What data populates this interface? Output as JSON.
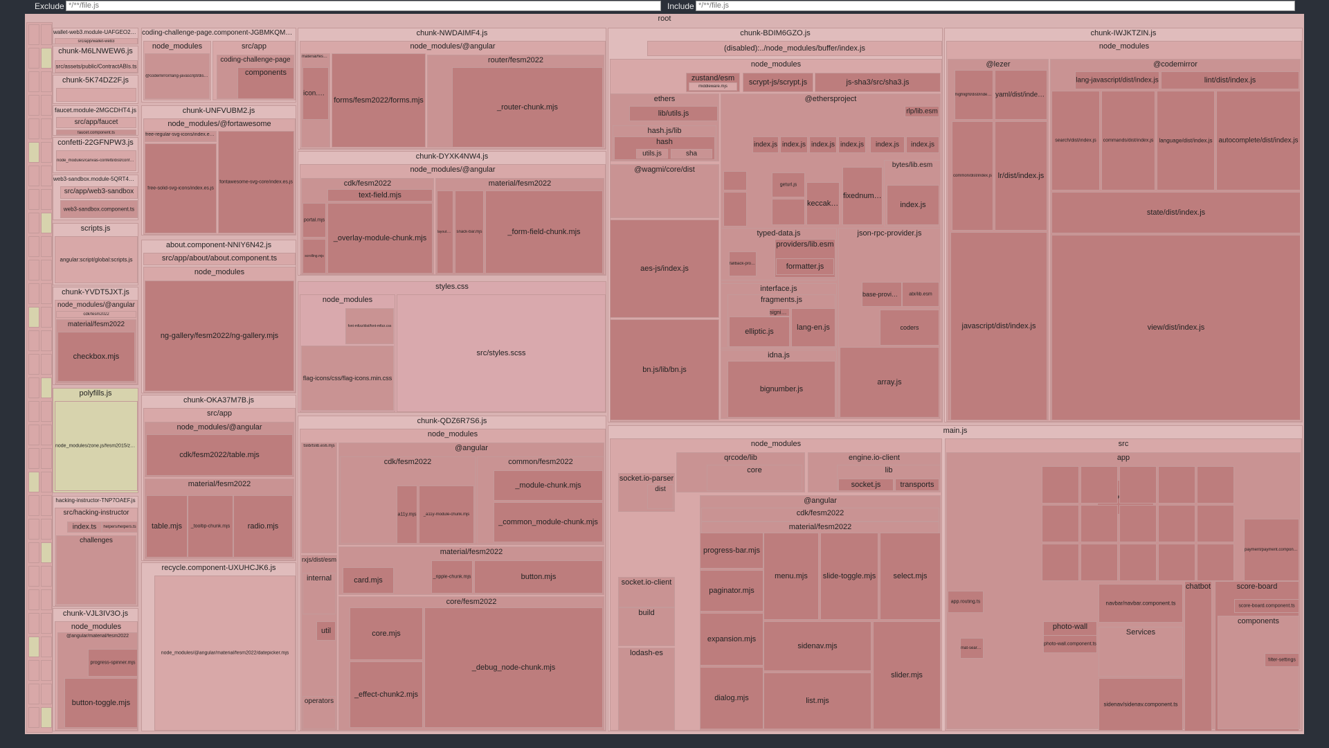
{
  "filters": {
    "exclude_label": "Exclude",
    "exclude_placeholder": "*/**/file.js",
    "include_label": "Include",
    "include_placeholder": "*/**/file.js"
  },
  "colors": {
    "root": "#d9b3b3",
    "default_chunk": "#e0bcbc",
    "polyfills": "#d7d3ad",
    "styles": "#d9a9ad",
    "module_dark": "#bd7d7d",
    "module_mid": "#c99393",
    "module_light": "#d8a8a8"
  },
  "treemap": {
    "root_label": "root",
    "chunks": [
      {
        "name": "wallet-web3.module-UAFGEO2L.js",
        "children": [
          "src/app/wallet-web3"
        ]
      },
      {
        "name": "chunk-M6LNWEW6.js",
        "children": [
          "src/assets/public/ContractABIs.ts"
        ]
      },
      {
        "name": "chunk-5K74DZ2F.js",
        "children": []
      },
      {
        "name": "faucet.module-2MGCDHT4.js",
        "children": [
          "src/app/faucet",
          "faucet.component.ts"
        ]
      },
      {
        "name": "confetti-22GFNPW3.js",
        "children": [
          "node_modules/canvas-confetti/dist/confetti.module.mjs"
        ]
      },
      {
        "name": "web3-sandbox.module-5QRT4YKN.js",
        "children": [
          "src/app/web3-sandbox",
          "web3-sandbox.component.ts"
        ]
      },
      {
        "name": "scripts.js",
        "children": [
          "angular:script/global:scripts.js"
        ]
      },
      {
        "name": "chunk-YVDT5JXT.js",
        "children": [
          "node_modules/@angular",
          "cdk/fesm2022",
          "material/fesm2022",
          "checkbox.mjs"
        ]
      },
      {
        "name": "polyfills.js",
        "children": [
          "node_modules/zone.js/fesm2015/zone.js"
        ]
      },
      {
        "name": "hacking-instructor-TNP7OAEF.js",
        "children": [
          "src/hacking-instructor",
          "index.ts",
          "helpers/helpers.ts",
          "challenges"
        ]
      },
      {
        "name": "chunk-VJL3IV3O.js",
        "children": [
          "node_modules",
          "@angular/material/fesm2022",
          "progress-spinner.mjs",
          "button-toggle.mjs"
        ]
      },
      {
        "name": "coding-challenge-page.component-JGBMKQMB.js",
        "children": [
          "node_modules",
          "src/app",
          "coding-challenge-page",
          "components",
          "@codemirror/lang-javascript/dist/index.js"
        ]
      },
      {
        "name": "chunk-UNFVUBM2.js",
        "children": [
          "node_modules/@fortawesome",
          "free-regular-svg-icons/index.es.js",
          "free-solid-svg-icons/index.es.js",
          "fontawesome-svg-core/index.es.js"
        ]
      },
      {
        "name": "about.component-NNIY6N42.js",
        "children": [
          "src/app/about/about.component.ts",
          "node_modules",
          "ng-gallery/fesm2022/ng-gallery.mjs"
        ]
      },
      {
        "name": "chunk-OKA37M7B.js",
        "children": [
          "src/app",
          "node_modules/@angular",
          "cdk/fesm2022/table.mjs",
          "material/fesm2022",
          "table.mjs",
          "_tooltip-chunk.mjs",
          "radio.mjs"
        ]
      },
      {
        "name": "recycle.component-UXUHCJK6.js",
        "children": [
          "node_modules/@angular/material/fesm2022/datepicker.mjs"
        ]
      },
      {
        "name": "chunk-NWDAIMF4.js",
        "children": [
          "node_modules/@angular",
          "router/fesm2022",
          "icon.mjs",
          "forms/fesm2022/forms.mjs",
          "_router-chunk.mjs",
          "material/fesm2022"
        ]
      },
      {
        "name": "chunk-DYXK4NW4.js",
        "children": [
          "node_modules/@angular",
          "cdk/fesm2022",
          "text-field.mjs",
          "material/fesm2022",
          "portal.mjs",
          "_overlay-module-chunk.mjs",
          "_form-field-chunk.mjs",
          "snack-bar.mjs",
          "scrolling.mjs",
          "layout.mjs"
        ]
      },
      {
        "name": "styles.css",
        "children": [
          "node_modules",
          "flag-icons/css/flag-icons.min.css",
          "font-mfizz/dist/font-mfizz.css",
          "src/styles.scss"
        ]
      },
      {
        "name": "chunk-QDZ6R7S6.js",
        "children": [
          "node_modules",
          "@angular",
          "cdk/fesm2022",
          "common/fesm2022",
          "_module-chunk.mjs",
          "_common_module-chunk.mjs",
          "a11y.mjs",
          "_a11y-module-chunk.mjs",
          "tslib/tslib.es6.mjs",
          "material/fesm2022",
          "card.mjs",
          "_ripple-chunk.mjs",
          "button.mjs",
          "rxjs/dist/esm",
          "internal",
          "util",
          "operators",
          "core/fesm2022",
          "core.mjs",
          "_debug_node-chunk.mjs",
          "_effect-chunk2.mjs"
        ]
      },
      {
        "name": "chunk-BDIM6GZO.js",
        "children": [
          "(disabled):../node_modules/buffer/index.js",
          "node_modules",
          "zustand/esm",
          "middleware.mjs",
          "scrypt-js/scrypt.js",
          "js-sha3/src/sha3.js",
          "ethers",
          "lib/utils.js",
          "hash.js/lib",
          "hash",
          "utils.js",
          "sha",
          "@wagmi/core/dist",
          "aes-js/index.js",
          "bn.js/lib/bn.js",
          "@ethersproject",
          "rlp/lib.esm",
          "index.js",
          "lib.esm",
          "bytes/lib.esm",
          "contracts/lib.esm",
          "hash/lib.esm",
          "ens-normalize",
          "include.js",
          "typed-data.js",
          "providers/lib.esm",
          "formatter.js",
          "fallback-provider.js",
          "json-rpc-provider.js",
          "base-provider.js",
          "abi/lib.esm",
          "coders",
          "array.js",
          "interface.js",
          "fragments.js",
          "signing-key/lib.esm",
          "elliptic.js",
          "lang-en.js",
          "idna.js",
          "bignumber.js",
          "fixednumber.js",
          "keccak256",
          "geturl.js"
        ]
      },
      {
        "name": "chunk-IWJKTZIN.js",
        "children": [
          "node_modules",
          "@lezer",
          "yaml/dist/index.js",
          "lr/dist/index.js",
          "javascript/dist/index.js",
          "highlight/dist/index.js",
          "common/dist/index.js",
          "@codemirror",
          "lang-javascript/dist/index.js",
          "lint/dist/index.js",
          "search/dist/index.js",
          "commands/dist/index.js",
          "language/dist/index.js",
          "autocomplete/dist/index.js",
          "state/dist/index.js",
          "view/dist/index.js"
        ]
      },
      {
        "name": "main.js",
        "children": [
          "node_modules",
          "qrcode/lib",
          "core",
          "engine.io-client",
          "lib",
          "socket.js",
          "transports",
          "socket.io-parser",
          "dist",
          "@angular",
          "cdk/fesm2022",
          "material/fesm2022",
          "progress-bar.mjs",
          "menu.mjs",
          "slide-toggle.mjs",
          "select.mjs",
          "paginator.mjs",
          "sidenav.mjs",
          "expansion.mjs",
          "slider.mjs",
          "dialog.mjs",
          "list.mjs",
          "socket.io-client",
          "build",
          "lodash-es",
          "src",
          "app",
          "app.routing.ts",
          "mat-search-bar",
          "navbar/navbar.component.ts",
          "chatbot",
          "score-board",
          "score-board.component.ts",
          "components",
          "filter-settings",
          "photo-wall",
          "photo-wall.component.ts",
          "Services",
          "sidenav/sidenav.component.ts",
          "login/login.component.ts",
          "payment/payment.component.ts"
        ]
      }
    ]
  }
}
